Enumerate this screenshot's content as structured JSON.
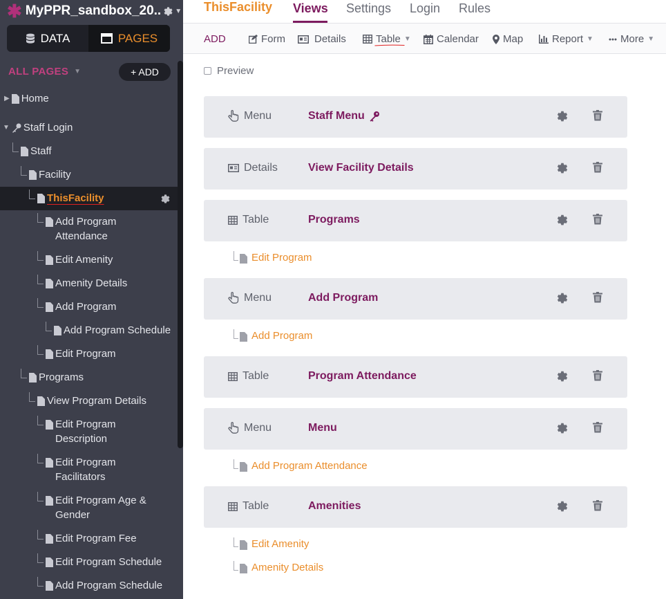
{
  "app": {
    "title": "MyPPR_sandbox_20..",
    "logo": "asterisk-logo-icon"
  },
  "nav": {
    "data_label": "DATA",
    "pages_label": "PAGES"
  },
  "sidebar": {
    "all_pages_label": "ALL PAGES",
    "add_label": "+ ADD",
    "tree": [
      {
        "label": "Home"
      },
      {
        "label": "Staff Login"
      },
      {
        "label": "Staff"
      },
      {
        "label": "Facility"
      },
      {
        "label": "ThisFacility"
      },
      {
        "label": "Add Program\nAttendance"
      },
      {
        "label": "Edit Amenity"
      },
      {
        "label": "Amenity Details"
      },
      {
        "label": "Add Program"
      },
      {
        "label": "Add Program Schedule"
      },
      {
        "label": "Edit Program"
      },
      {
        "label": "Programs"
      },
      {
        "label": "View Program Details"
      },
      {
        "label": "Edit Program\nDescription"
      },
      {
        "label": "Edit Program\nFacilitators"
      },
      {
        "label": "Edit Program Age &\nGender"
      },
      {
        "label": "Edit Program Fee"
      },
      {
        "label": "Edit Program Schedule"
      },
      {
        "label": "Add Program Schedule"
      }
    ]
  },
  "header": {
    "page_title": "ThisFacility",
    "tabs": [
      {
        "label": "Views"
      },
      {
        "label": "Settings"
      },
      {
        "label": "Login"
      },
      {
        "label": "Rules"
      }
    ]
  },
  "toolbar": {
    "add_label": "ADD",
    "form_label": "Form",
    "details_label": "Details",
    "table_label": "Table",
    "calendar_label": "Calendar",
    "map_label": "Map",
    "report_label": "Report",
    "more_label": "More"
  },
  "preview_label": "Preview",
  "views": [
    {
      "type": "Menu",
      "name": "Staff Menu"
    },
    {
      "type": "Details",
      "name": "View Facility Details"
    },
    {
      "type": "Table",
      "name": "Programs"
    },
    {
      "type": "Menu",
      "name": "Add Program"
    },
    {
      "type": "Table",
      "name": "Program Attendance"
    },
    {
      "type": "Menu",
      "name": "Menu"
    },
    {
      "type": "Table",
      "name": "Amenities"
    }
  ],
  "child_links": [
    {
      "label": "Edit Program"
    },
    {
      "label": "Add Program"
    },
    {
      "label": "Add Program Attendance"
    },
    {
      "label": "Edit Amenity"
    },
    {
      "label": "Amenity Details"
    }
  ],
  "colors": {
    "accent": "#7d1b5f",
    "orange": "#ea8e2c",
    "sidebar": "#3d3f4b"
  }
}
